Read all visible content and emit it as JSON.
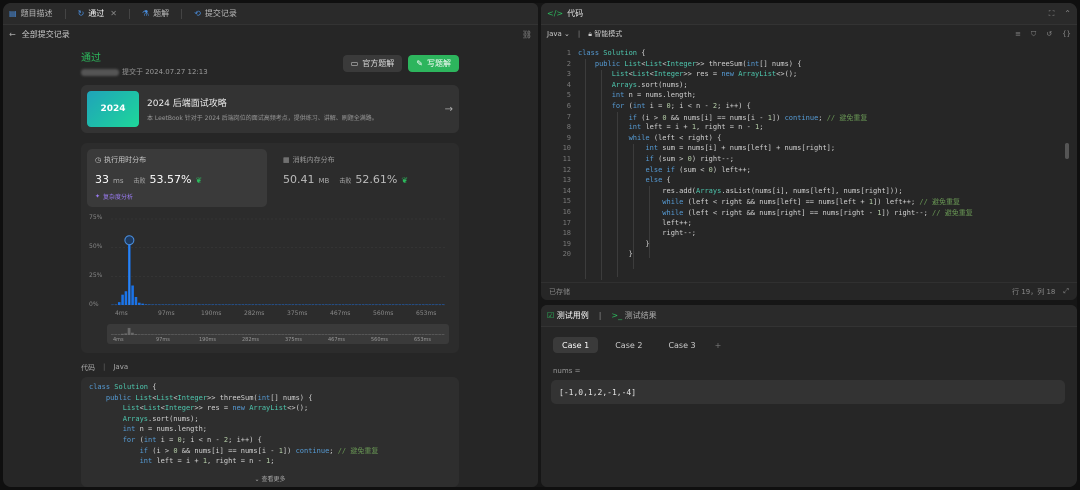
{
  "left_tabs": [
    {
      "label": "题目描述",
      "icon": "document-icon"
    },
    {
      "label": "通过",
      "icon": "history-icon",
      "active": true
    },
    {
      "label": "题解",
      "icon": "flask-icon"
    },
    {
      "label": "提交记录",
      "icon": "history-icon"
    }
  ],
  "back_label": "全部提交记录",
  "submission": {
    "status": "通过",
    "submitted_at": "提交于 2024.07.27 12:13",
    "official_btn": "官方题解",
    "write_btn": "写题解"
  },
  "promo": {
    "badge": "2024",
    "title": "2024 后端面试攻略",
    "desc": "本 LeetBook 针对于 2024 后端岗位的面试高频考点，提供练习、讲解、刷题全满路。"
  },
  "runtime": {
    "title": "执行用时分布",
    "value": "33",
    "unit": "ms",
    "beat_label": "击败",
    "percent": "53.57%",
    "analysis": "复杂度分析"
  },
  "memory": {
    "title": "消耗内存分布",
    "value": "50.41",
    "unit": "MB",
    "beat_label": "击败",
    "percent": "52.61%"
  },
  "chart_data": {
    "type": "bar",
    "y_ticks": [
      "75%",
      "50%",
      "25%",
      "0%"
    ],
    "x_ticks": [
      "4ms",
      "97ms",
      "190ms",
      "282ms",
      "375ms",
      "467ms",
      "560ms",
      "653ms"
    ],
    "range_ticks": [
      "4ms",
      "97ms",
      "190ms",
      "282ms",
      "375ms",
      "467ms",
      "560ms",
      "653ms"
    ],
    "ylim": [
      0,
      75
    ],
    "highlight_bar_index": 5,
    "values": [
      0.3,
      0.4,
      2.5,
      9,
      12,
      53,
      17,
      7,
      2,
      1.2,
      0.6,
      0.5,
      0.4,
      0.4,
      0.4,
      0.4,
      0.4,
      0.4,
      0.4,
      0.4,
      0.4,
      0.4,
      0.4,
      0.4,
      0.4,
      0.4,
      0.4,
      0.4,
      0.4,
      0.4,
      0.4,
      0.4,
      0.4,
      0.4,
      0.4,
      0.4,
      0.4,
      0.4,
      0.4,
      0.4,
      0.4,
      0.4,
      0.4,
      0.4,
      0.4,
      0.4,
      0.4,
      0.4,
      0.4,
      0.4,
      0.4,
      0.4,
      0.4,
      0.4,
      0.4,
      0.4,
      0.4,
      0.4,
      0.4,
      0.4,
      0.4,
      0.4,
      0.4,
      0.4,
      0.4,
      0.4,
      0.4,
      0.4,
      0.4,
      0.4,
      0.4,
      0.4,
      0.4,
      0.4,
      0.4,
      0.4,
      0.4,
      0.4,
      0.4,
      0.4,
      0.4,
      0.4,
      0.4,
      0.4,
      0.4,
      0.4,
      0.4,
      0.4,
      0.4,
      0.4,
      0.4,
      0.4,
      0.4,
      0.4,
      0.4,
      0.4,
      0.4,
      0.4,
      0.4,
      0.4
    ]
  },
  "code_section": {
    "label": "代码",
    "lang": "Java",
    "lines": [
      "class Solution {",
      "    public List<List<Integer>> threeSum(int[] nums) {",
      "        List<List<Integer>> res = new ArrayList<>();",
      "        Arrays.sort(nums);",
      "        int n = nums.length;",
      "        for (int i = 0; i < n - 2; i++) {",
      "            if (i > 0 && nums[i] == nums[i - 1]) continue; // 避免重复",
      "            int left = i + 1, right = n - 1;"
    ],
    "more": "查看更多"
  },
  "editor": {
    "title": "代码",
    "lang": "Java",
    "mode": "智能模式",
    "line_numbers": [
      "1",
      "2",
      "3",
      "4",
      "5",
      "6",
      "7",
      "8",
      "9",
      "10",
      "11",
      "12",
      "13",
      "14",
      "15",
      "16",
      "17",
      "18",
      "19",
      "20"
    ],
    "lines": [
      "class Solution {",
      "    public List<List<Integer>> threeSum(int[] nums) {",
      "        List<List<Integer>> res = new ArrayList<>();",
      "        Arrays.sort(nums);",
      "        int n = nums.length;",
      "        for (int i = 0; i < n - 2; i++) {",
      "            if (i > 0 && nums[i] == nums[i - 1]) continue; // 避免重复",
      "            int left = i + 1, right = n - 1;",
      "            while (left < right) {",
      "                int sum = nums[i] + nums[left] + nums[right];",
      "                if (sum > 0) right--;",
      "                else if (sum < 0) left++;",
      "                else {",
      "                    res.add(Arrays.asList(nums[i], nums[left], nums[right]));",
      "                    while (left < right && nums[left] == nums[left + 1]) left++; // 避免重复",
      "                    while (left < right && nums[right] == nums[right - 1]) right--; // 避免重复",
      "                    left++;",
      "                    right--;",
      "                }",
      "            }"
    ],
    "saved": "已存储",
    "cursor": "行 19，列 18"
  },
  "tests": {
    "tab_cases": "测试用例",
    "tab_result": "测试结果",
    "cases": [
      "Case 1",
      "Case 2",
      "Case 3"
    ],
    "add": "+",
    "var_label": "nums =",
    "value": "[-1,0,1,2,-1,-4]"
  },
  "colors": {
    "accent_green": "#2cbb5d",
    "bar_blue": "#1a73e8"
  }
}
